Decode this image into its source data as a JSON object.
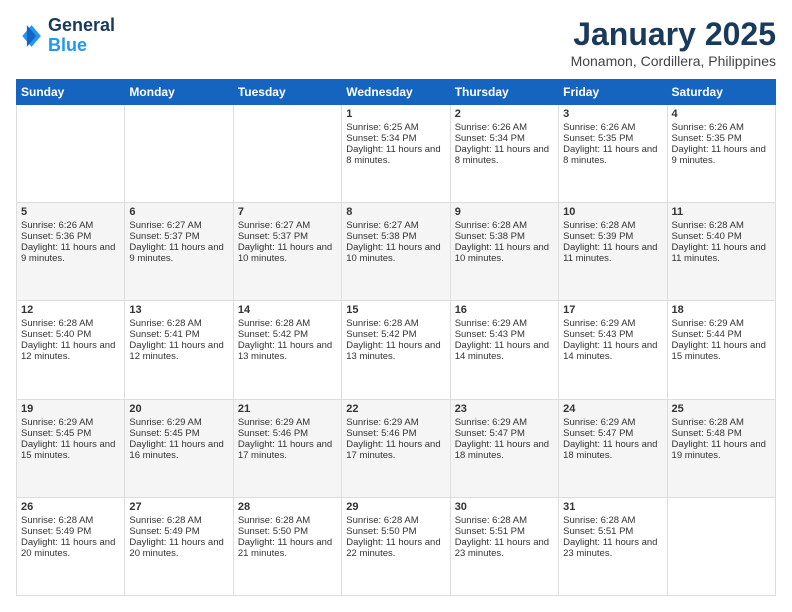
{
  "logo": {
    "line1": "General",
    "line2": "Blue"
  },
  "header": {
    "title": "January 2025",
    "subtitle": "Monamon, Cordillera, Philippines"
  },
  "weekdays": [
    "Sunday",
    "Monday",
    "Tuesday",
    "Wednesday",
    "Thursday",
    "Friday",
    "Saturday"
  ],
  "weeks": [
    [
      {
        "day": "",
        "sunrise": "",
        "sunset": "",
        "daylight": ""
      },
      {
        "day": "",
        "sunrise": "",
        "sunset": "",
        "daylight": ""
      },
      {
        "day": "",
        "sunrise": "",
        "sunset": "",
        "daylight": ""
      },
      {
        "day": "1",
        "sunrise": "Sunrise: 6:25 AM",
        "sunset": "Sunset: 5:34 PM",
        "daylight": "Daylight: 11 hours and 8 minutes."
      },
      {
        "day": "2",
        "sunrise": "Sunrise: 6:26 AM",
        "sunset": "Sunset: 5:34 PM",
        "daylight": "Daylight: 11 hours and 8 minutes."
      },
      {
        "day": "3",
        "sunrise": "Sunrise: 6:26 AM",
        "sunset": "Sunset: 5:35 PM",
        "daylight": "Daylight: 11 hours and 8 minutes."
      },
      {
        "day": "4",
        "sunrise": "Sunrise: 6:26 AM",
        "sunset": "Sunset: 5:35 PM",
        "daylight": "Daylight: 11 hours and 9 minutes."
      }
    ],
    [
      {
        "day": "5",
        "sunrise": "Sunrise: 6:26 AM",
        "sunset": "Sunset: 5:36 PM",
        "daylight": "Daylight: 11 hours and 9 minutes."
      },
      {
        "day": "6",
        "sunrise": "Sunrise: 6:27 AM",
        "sunset": "Sunset: 5:37 PM",
        "daylight": "Daylight: 11 hours and 9 minutes."
      },
      {
        "day": "7",
        "sunrise": "Sunrise: 6:27 AM",
        "sunset": "Sunset: 5:37 PM",
        "daylight": "Daylight: 11 hours and 10 minutes."
      },
      {
        "day": "8",
        "sunrise": "Sunrise: 6:27 AM",
        "sunset": "Sunset: 5:38 PM",
        "daylight": "Daylight: 11 hours and 10 minutes."
      },
      {
        "day": "9",
        "sunrise": "Sunrise: 6:28 AM",
        "sunset": "Sunset: 5:38 PM",
        "daylight": "Daylight: 11 hours and 10 minutes."
      },
      {
        "day": "10",
        "sunrise": "Sunrise: 6:28 AM",
        "sunset": "Sunset: 5:39 PM",
        "daylight": "Daylight: 11 hours and 11 minutes."
      },
      {
        "day": "11",
        "sunrise": "Sunrise: 6:28 AM",
        "sunset": "Sunset: 5:40 PM",
        "daylight": "Daylight: 11 hours and 11 minutes."
      }
    ],
    [
      {
        "day": "12",
        "sunrise": "Sunrise: 6:28 AM",
        "sunset": "Sunset: 5:40 PM",
        "daylight": "Daylight: 11 hours and 12 minutes."
      },
      {
        "day": "13",
        "sunrise": "Sunrise: 6:28 AM",
        "sunset": "Sunset: 5:41 PM",
        "daylight": "Daylight: 11 hours and 12 minutes."
      },
      {
        "day": "14",
        "sunrise": "Sunrise: 6:28 AM",
        "sunset": "Sunset: 5:42 PM",
        "daylight": "Daylight: 11 hours and 13 minutes."
      },
      {
        "day": "15",
        "sunrise": "Sunrise: 6:28 AM",
        "sunset": "Sunset: 5:42 PM",
        "daylight": "Daylight: 11 hours and 13 minutes."
      },
      {
        "day": "16",
        "sunrise": "Sunrise: 6:29 AM",
        "sunset": "Sunset: 5:43 PM",
        "daylight": "Daylight: 11 hours and 14 minutes."
      },
      {
        "day": "17",
        "sunrise": "Sunrise: 6:29 AM",
        "sunset": "Sunset: 5:43 PM",
        "daylight": "Daylight: 11 hours and 14 minutes."
      },
      {
        "day": "18",
        "sunrise": "Sunrise: 6:29 AM",
        "sunset": "Sunset: 5:44 PM",
        "daylight": "Daylight: 11 hours and 15 minutes."
      }
    ],
    [
      {
        "day": "19",
        "sunrise": "Sunrise: 6:29 AM",
        "sunset": "Sunset: 5:45 PM",
        "daylight": "Daylight: 11 hours and 15 minutes."
      },
      {
        "day": "20",
        "sunrise": "Sunrise: 6:29 AM",
        "sunset": "Sunset: 5:45 PM",
        "daylight": "Daylight: 11 hours and 16 minutes."
      },
      {
        "day": "21",
        "sunrise": "Sunrise: 6:29 AM",
        "sunset": "Sunset: 5:46 PM",
        "daylight": "Daylight: 11 hours and 17 minutes."
      },
      {
        "day": "22",
        "sunrise": "Sunrise: 6:29 AM",
        "sunset": "Sunset: 5:46 PM",
        "daylight": "Daylight: 11 hours and 17 minutes."
      },
      {
        "day": "23",
        "sunrise": "Sunrise: 6:29 AM",
        "sunset": "Sunset: 5:47 PM",
        "daylight": "Daylight: 11 hours and 18 minutes."
      },
      {
        "day": "24",
        "sunrise": "Sunrise: 6:29 AM",
        "sunset": "Sunset: 5:47 PM",
        "daylight": "Daylight: 11 hours and 18 minutes."
      },
      {
        "day": "25",
        "sunrise": "Sunrise: 6:28 AM",
        "sunset": "Sunset: 5:48 PM",
        "daylight": "Daylight: 11 hours and 19 minutes."
      }
    ],
    [
      {
        "day": "26",
        "sunrise": "Sunrise: 6:28 AM",
        "sunset": "Sunset: 5:49 PM",
        "daylight": "Daylight: 11 hours and 20 minutes."
      },
      {
        "day": "27",
        "sunrise": "Sunrise: 6:28 AM",
        "sunset": "Sunset: 5:49 PM",
        "daylight": "Daylight: 11 hours and 20 minutes."
      },
      {
        "day": "28",
        "sunrise": "Sunrise: 6:28 AM",
        "sunset": "Sunset: 5:50 PM",
        "daylight": "Daylight: 11 hours and 21 minutes."
      },
      {
        "day": "29",
        "sunrise": "Sunrise: 6:28 AM",
        "sunset": "Sunset: 5:50 PM",
        "daylight": "Daylight: 11 hours and 22 minutes."
      },
      {
        "day": "30",
        "sunrise": "Sunrise: 6:28 AM",
        "sunset": "Sunset: 5:51 PM",
        "daylight": "Daylight: 11 hours and 23 minutes."
      },
      {
        "day": "31",
        "sunrise": "Sunrise: 6:28 AM",
        "sunset": "Sunset: 5:51 PM",
        "daylight": "Daylight: 11 hours and 23 minutes."
      },
      {
        "day": "",
        "sunrise": "",
        "sunset": "",
        "daylight": ""
      }
    ]
  ]
}
